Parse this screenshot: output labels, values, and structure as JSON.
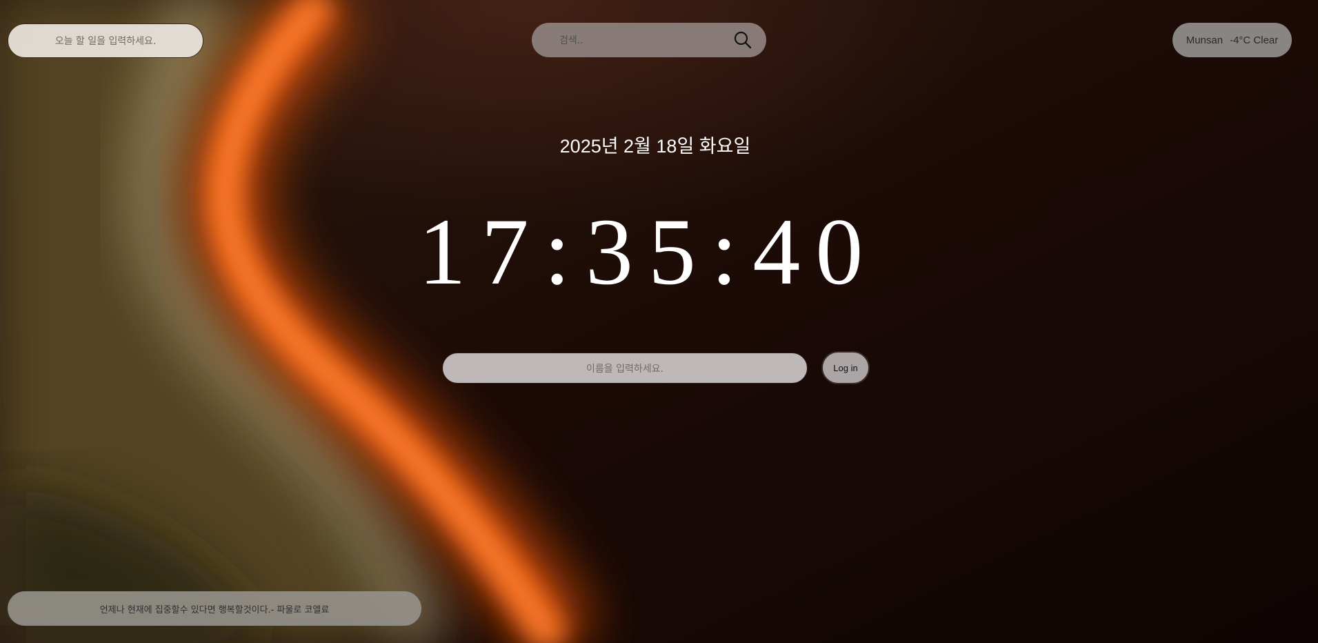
{
  "todo": {
    "placeholder": "오늘 할 일을 입력하세요."
  },
  "search": {
    "placeholder": "검색..",
    "icon": "search-icon"
  },
  "weather": {
    "city": "Munsan",
    "temp_condition": "-4°C Clear"
  },
  "date": {
    "text": "2025년 2월 18일 화요일"
  },
  "clock": {
    "time": "17:35:40"
  },
  "login": {
    "name_placeholder": "이름을 입력하세요.",
    "button_label": "Log in"
  },
  "quote": {
    "text": "언제나 현재에 집중할수 있다면 행복할것이다.- 파울로 코엘료"
  }
}
